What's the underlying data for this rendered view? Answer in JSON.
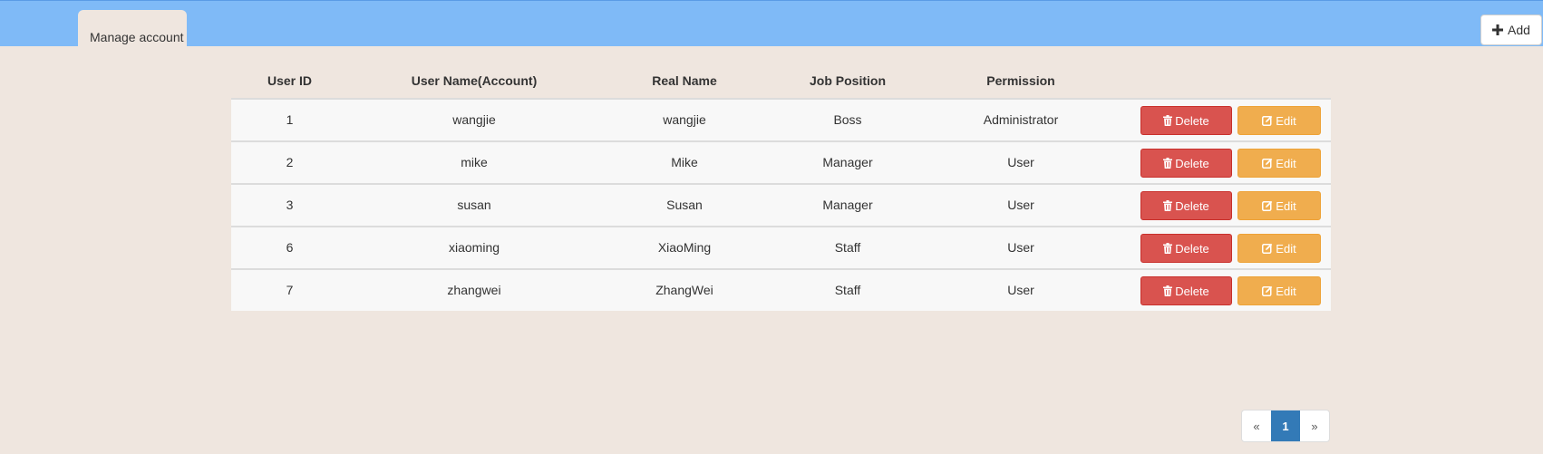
{
  "header": {
    "tab_label": "Manage account",
    "add_label": "Add"
  },
  "table": {
    "columns": [
      "User ID",
      "User Name(Account)",
      "Real Name",
      "Job Position",
      "Permission"
    ],
    "rows": [
      {
        "id": "1",
        "username": "wangjie",
        "realname": "wangjie",
        "position": "Boss",
        "permission": "Administrator"
      },
      {
        "id": "2",
        "username": "mike",
        "realname": "Mike",
        "position": "Manager",
        "permission": "User"
      },
      {
        "id": "3",
        "username": "susan",
        "realname": "Susan",
        "position": "Manager",
        "permission": "User"
      },
      {
        "id": "6",
        "username": "xiaoming",
        "realname": "XiaoMing",
        "position": "Staff",
        "permission": "User"
      },
      {
        "id": "7",
        "username": "zhangwei",
        "realname": "ZhangWei",
        "position": "Staff",
        "permission": "User"
      }
    ],
    "delete_label": "Delete",
    "edit_label": "Edit"
  },
  "pagination": {
    "prev": "«",
    "pages": [
      "1"
    ],
    "current": "1",
    "next": "»"
  },
  "colors": {
    "topbar": "#7fbaf7",
    "background": "#efe6df",
    "delete": "#d9534f",
    "edit": "#f0ad4e",
    "page_active": "#337ab7"
  },
  "icons": {
    "add": "plus-icon",
    "delete": "trash-icon",
    "edit": "edit-icon"
  }
}
